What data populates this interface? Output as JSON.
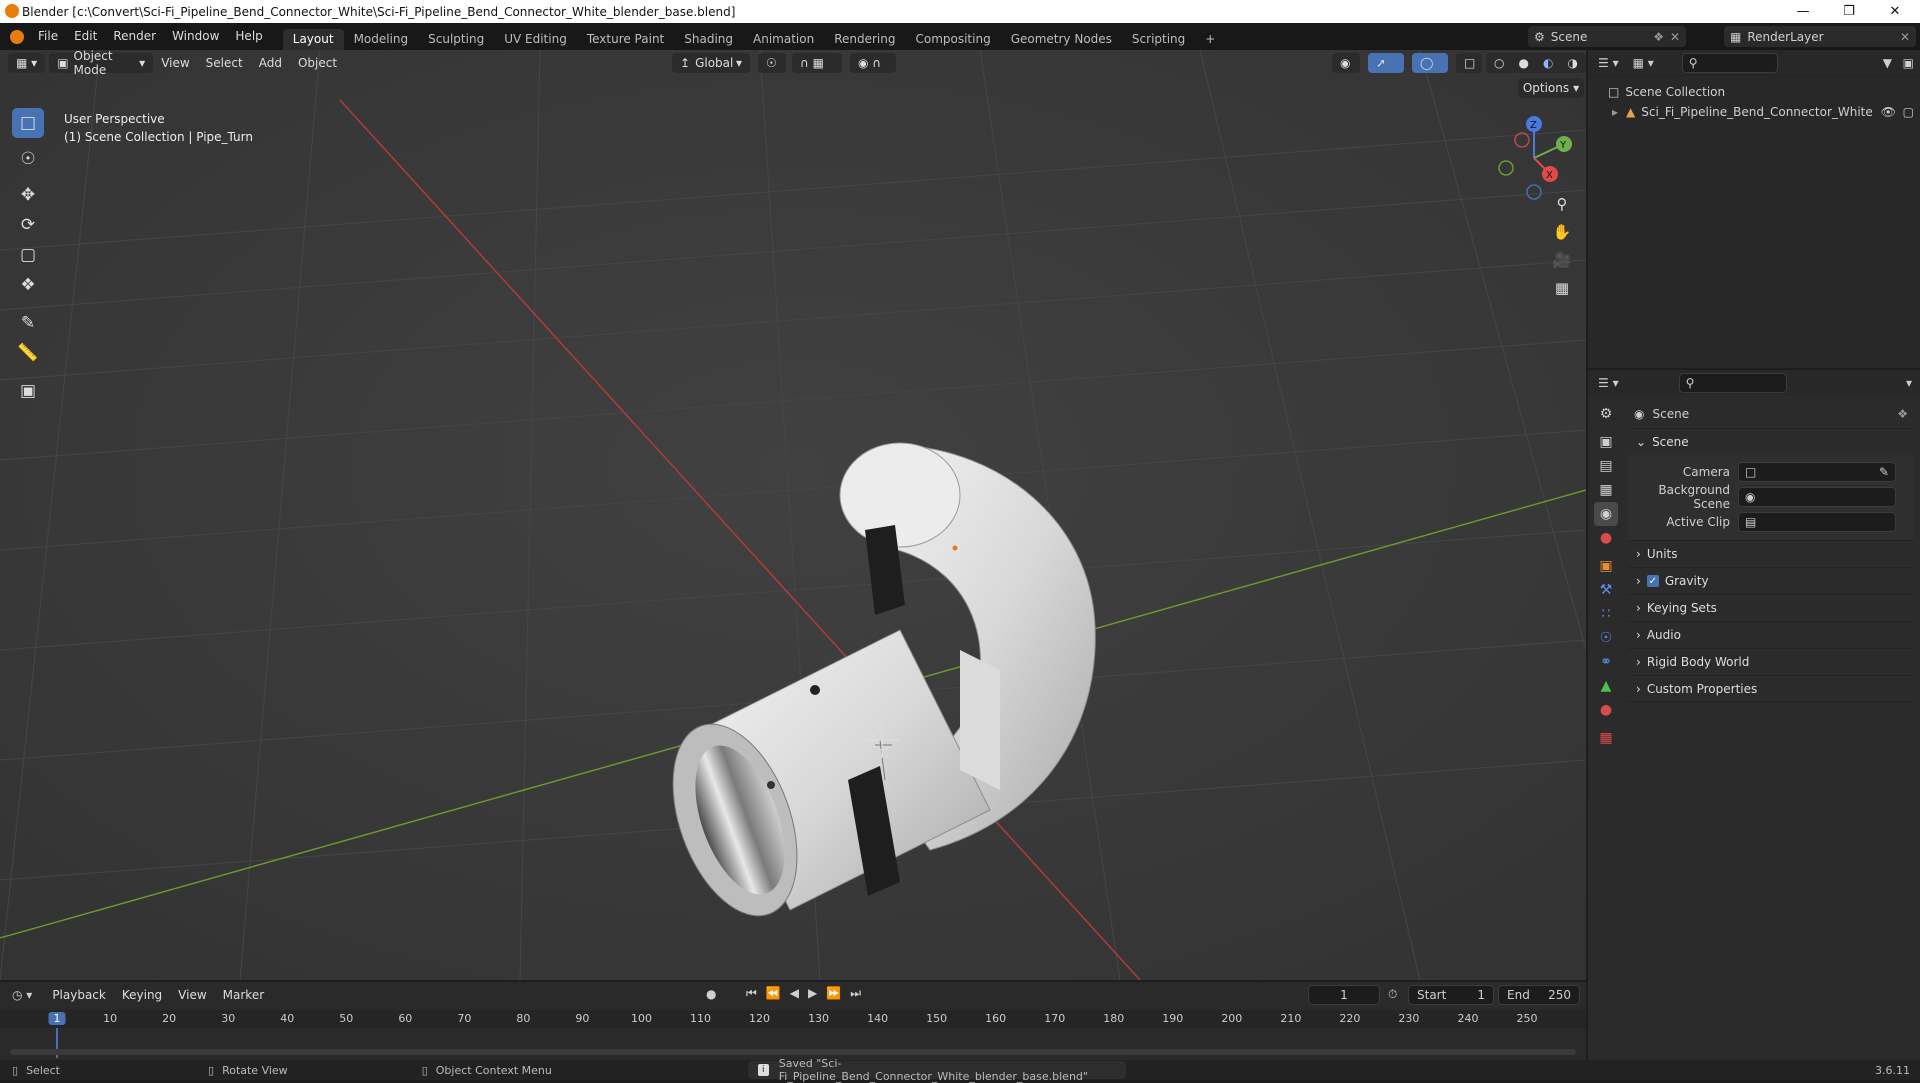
{
  "window": {
    "title": "Blender [c:\\Convert\\Sci-Fi_Pipeline_Bend_Connector_White\\Sci-Fi_Pipeline_Bend_Connector_White_blender_base.blend]"
  },
  "menu": [
    "File",
    "Edit",
    "Render",
    "Window",
    "Help"
  ],
  "workspaces": [
    "Layout",
    "Modeling",
    "Sculpting",
    "UV Editing",
    "Texture Paint",
    "Shading",
    "Animation",
    "Rendering",
    "Compositing",
    "Geometry Nodes",
    "Scripting"
  ],
  "active_workspace": "Layout",
  "scene_selector": "Scene",
  "renderlayer_selector": "RenderLayer",
  "viewport": {
    "mode": "Object Mode",
    "menus": [
      "View",
      "Select",
      "Add",
      "Object"
    ],
    "orientation": "Global",
    "options_label": "Options",
    "overlay_line1": "User Perspective",
    "overlay_line2": "(1) Scene Collection | Pipe_Turn",
    "gizmo": {
      "x": "X",
      "y": "Y",
      "z": "Z"
    },
    "tools": [
      "select-box-icon",
      "cursor-icon",
      "move-icon",
      "rotate-icon",
      "scale-icon",
      "transform-icon",
      "annotate-icon",
      "measure-icon",
      "add-cube-icon"
    ]
  },
  "outliner": {
    "root": "Scene Collection",
    "items": [
      {
        "label": "Sci_Fi_Pipeline_Bend_Connector_White"
      }
    ]
  },
  "properties": {
    "context_title": "Scene",
    "panel_title": "Scene",
    "fields": [
      {
        "label": "Camera"
      },
      {
        "label": "Background Scene"
      },
      {
        "label": "Active Clip"
      }
    ],
    "panels": [
      "Units",
      "Gravity",
      "Keying Sets",
      "Audio",
      "Rigid Body World",
      "Custom Properties"
    ],
    "gravity_checked": true
  },
  "timeline": {
    "menus": [
      "Playback",
      "Keying",
      "View",
      "Marker"
    ],
    "current_frame": "1",
    "start_label": "Start",
    "start": "1",
    "end_label": "End",
    "end": "250",
    "ruler": [
      "1",
      "10",
      "20",
      "30",
      "40",
      "50",
      "60",
      "70",
      "80",
      "90",
      "100",
      "110",
      "120",
      "130",
      "140",
      "150",
      "160",
      "170",
      "180",
      "190",
      "200",
      "210",
      "220",
      "230",
      "240",
      "250"
    ]
  },
  "status": {
    "select": "Select",
    "rotate": "Rotate View",
    "context": "Object Context Menu",
    "message": "Saved \"Sci-Fi_Pipeline_Bend_Connector_White_blender_base.blend\"",
    "version": "3.6.11"
  },
  "colors": {
    "accent": "#4772b3",
    "axis_x": "#b83a3a",
    "axis_y": "#6d9a2f",
    "blender_orange": "#e87d0d"
  }
}
